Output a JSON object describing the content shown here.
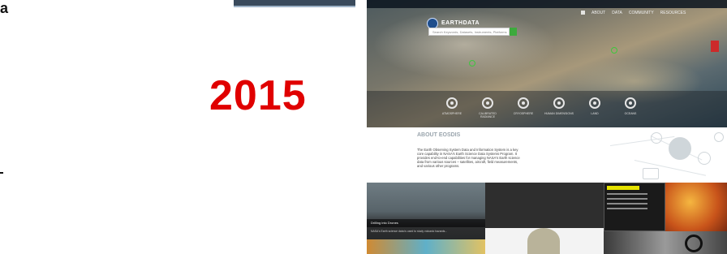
{
  "slide": {
    "year_label": "2015",
    "corner_glyph": "a"
  },
  "screenshot": {
    "brand": "EARTHDATA",
    "brand_sub": "FIND DATA · USE DATA",
    "nav": [
      "ABOUT",
      "DATA",
      "COMMUNITY",
      "RESOURCES"
    ],
    "search_placeholder": "Search Keywords, Datasets, Instruments, Platforms",
    "icon_captions": [
      "ATMOSPHERE",
      "CALIBRATED RADIANCE",
      "CRYOSPHERE",
      "HUMAN DIMENSIONS",
      "LAND",
      "OCEANS"
    ],
    "about_title": "ABOUT EOSDIS",
    "about_text": "The Earth Observing System Data and Information System is a key core capability in NASA's Earth Science Data Systems Program. It provides end-to-end capabilities for managing NASA's Earth science data from various sources – satellites, aircraft, field measurements, and various other programs.",
    "photo_title": "Drilling into Drones",
    "photo_caption": "NASA's Earth science data is used to study volcanic hazards..."
  },
  "colors": {
    "year": "#e00000",
    "accent_green": "#3daa3d",
    "accent_red": "#cc2a2a"
  }
}
